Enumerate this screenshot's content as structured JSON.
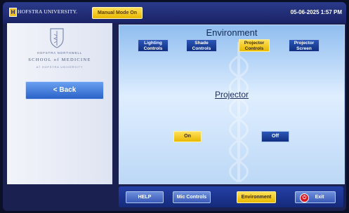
{
  "header": {
    "logo_letter": "H",
    "university": "HOFSTRA UNIVERSITY.",
    "manual_mode": "Manual Mode On",
    "datetime": "05-06-2025 1:57 PM"
  },
  "left_panel": {
    "school_line1": "HOFSTRA NORTHWELL",
    "school_line2": "SCHOOL of MEDICINE",
    "school_line3": "AT HOFSTRA UNIVERSITY",
    "back_label": "< Back"
  },
  "main": {
    "title": "Environment",
    "tabs": [
      {
        "label1": "Lighting",
        "label2": "Controls"
      },
      {
        "label1": "Shade",
        "label2": "Controls"
      },
      {
        "label1": "Projector",
        "label2": "Controls"
      },
      {
        "label1": "Projector",
        "label2": "Screen"
      }
    ],
    "active_tab": 2,
    "section_title": "Projector",
    "on_label": "On",
    "off_label": "Off"
  },
  "footer": {
    "help": "HELP",
    "mic": "Mic Controls",
    "environment": "Environment",
    "exit": "Exit"
  },
  "colors": {
    "accent_yellow": "#f0c020",
    "accent_blue": "#1b2f86",
    "exit_red": "#d61a22"
  }
}
